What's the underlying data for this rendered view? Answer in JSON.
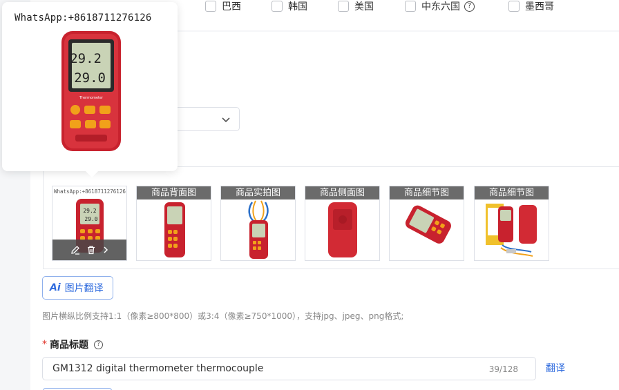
{
  "countries": [
    {
      "label": "巴西"
    },
    {
      "label": "韩国"
    },
    {
      "label": "美国"
    },
    {
      "label": "中东六国"
    },
    {
      "label": "墨西哥"
    }
  ],
  "popover": {
    "watermark": "WhatsApp:+8618711276126"
  },
  "gallery": {
    "first_watermark": "WhatsApp:+8618711276126",
    "thumbnails": [
      {
        "tag": "商品背面图"
      },
      {
        "tag": "商品实拍图"
      },
      {
        "tag": "商品侧面图"
      },
      {
        "tag": "商品细节图"
      },
      {
        "tag": "商品细节图"
      }
    ]
  },
  "image_translate_button": {
    "ai_text": "Ai",
    "label": "图片翻译"
  },
  "image_hint": "图片横纵比例支持1:1（像素≥800*800）或3:4（像素≥750*1000），支持jpg、jpeg、png格式;",
  "product_title": {
    "required_mark": "*",
    "label": "商品标题",
    "help_icon_text": "?",
    "value": "GM1312 digital thermometer thermocouple",
    "count": "39/128",
    "translate_label": "翻译"
  },
  "colors": {
    "accent": "#2f6bde",
    "required": "#e0352b",
    "device_red": "#c8222e",
    "tag_bg": "#6b6b6b"
  }
}
